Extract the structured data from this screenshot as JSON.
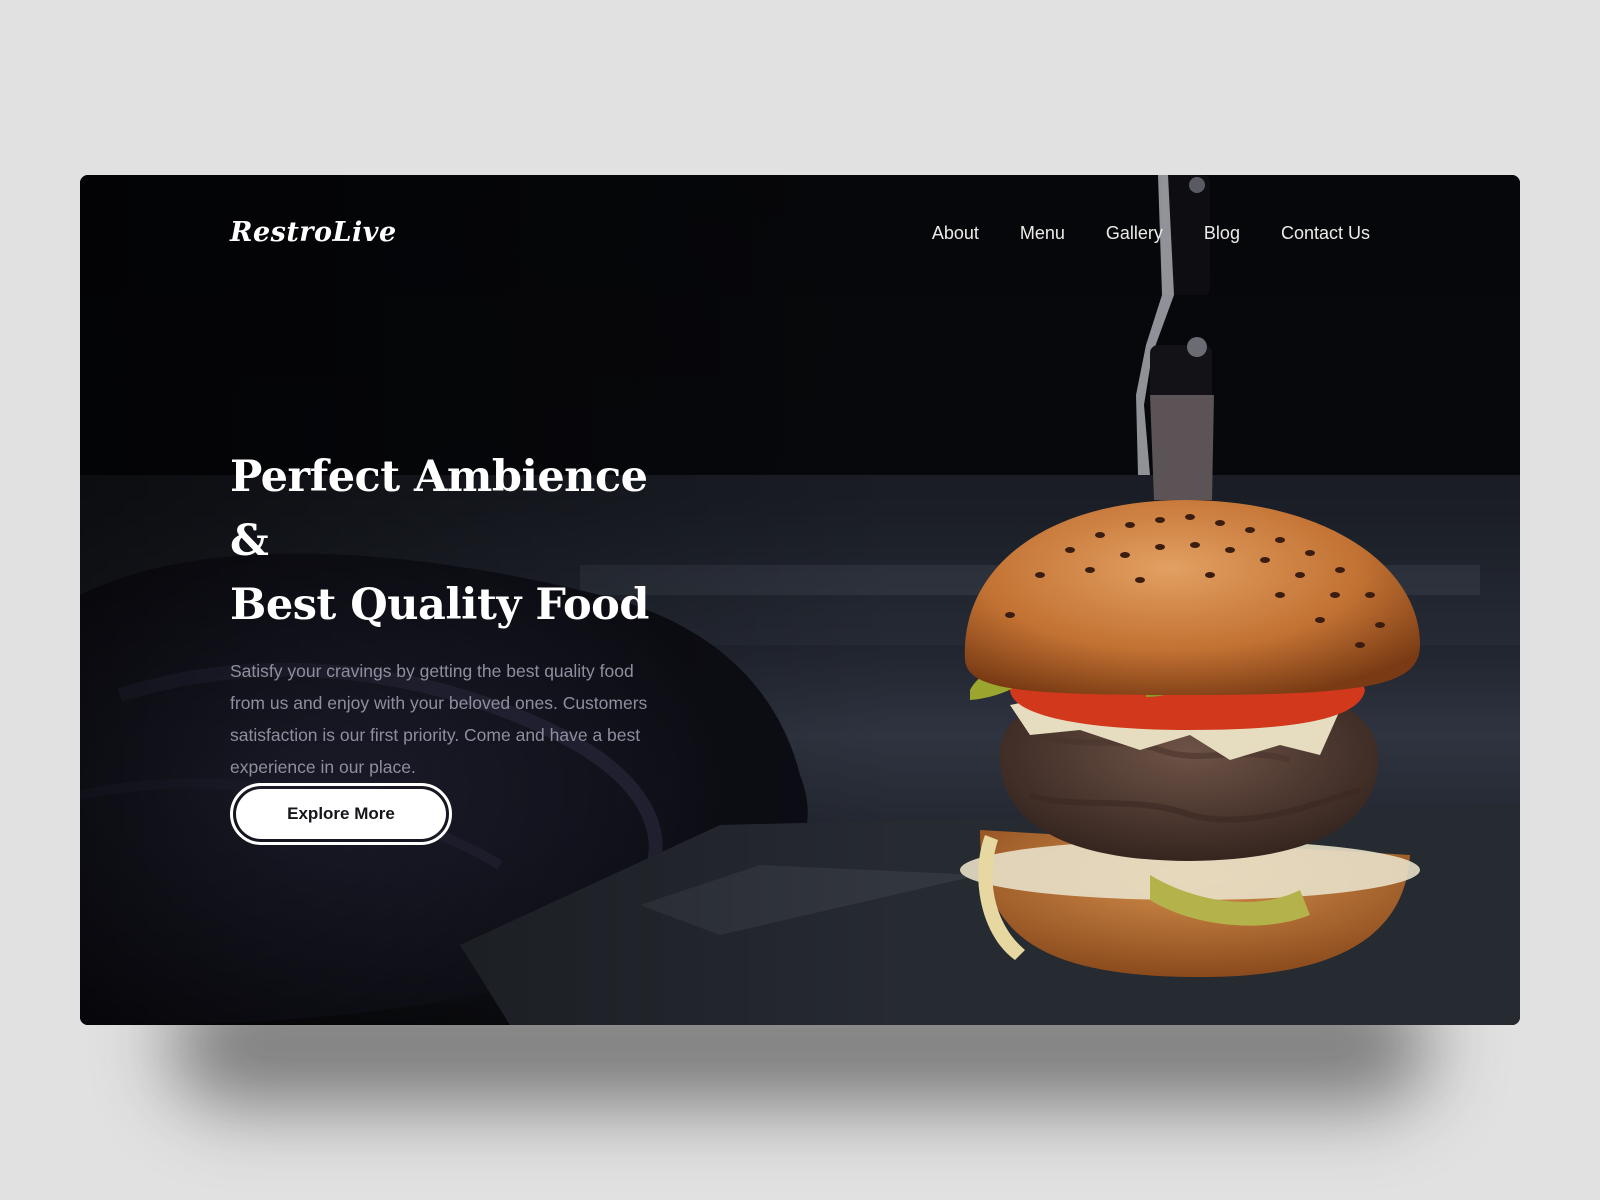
{
  "brand": {
    "logo_text": "RestroLive"
  },
  "nav": {
    "items": [
      {
        "label": "About"
      },
      {
        "label": "Menu"
      },
      {
        "label": "Gallery"
      },
      {
        "label": "Blog"
      },
      {
        "label": "Contact Us"
      }
    ]
  },
  "hero": {
    "headline_line1": "Perfect Ambience &",
    "headline_line2": "Best Quality Food",
    "description": "Satisfy your cravings by getting the best quality food from us and enjoy with your beloved ones. Customers satisfaction is our first priority. Come and have a best experience in our place.",
    "cta_label": "Explore More",
    "image_subject": "burger-with-knife"
  },
  "colors": {
    "page_background": "#e1e1e1",
    "hero_background": "#050507",
    "text_primary": "#ffffff",
    "text_muted": "#8d8f9e",
    "bun": "#c97a35",
    "tomato": "#d2381c"
  }
}
